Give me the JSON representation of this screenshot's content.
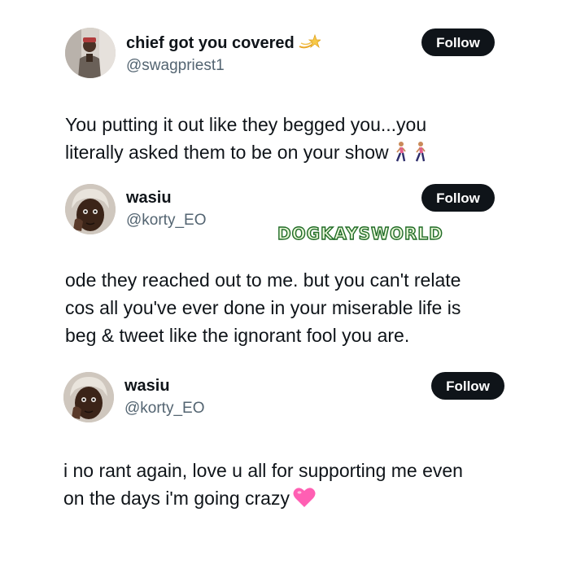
{
  "watermark": "DOGKAYSWORLD",
  "posts": [
    {
      "display_name": "chief got you covered",
      "name_icon": "dizzy-star-icon",
      "handle": "@swagpriest1",
      "follow_label": "Follow",
      "lines": [
        "You putting it out like they begged you...you",
        "literally asked them to be on your show"
      ],
      "trailing_icons": [
        "woman-walking-icon",
        "woman-walking-icon"
      ]
    },
    {
      "display_name": "wasiu",
      "handle": "@korty_EO",
      "follow_label": "Follow",
      "lines": [
        "ode they reached out to me. but you can't relate",
        "cos all you've ever done in your miserable life is",
        "beg & tweet like the ignorant fool you are."
      ]
    },
    {
      "display_name": "wasiu",
      "handle": "@korty_EO",
      "follow_label": "Follow",
      "lines": [
        "i no rant again, love u all for supporting me even",
        "on the days i'm going crazy"
      ],
      "trailing_icons": [
        "pink-heart-icon"
      ]
    }
  ],
  "colors": {
    "text": "#0f1419",
    "handle": "#536471",
    "button_bg": "#0f1419",
    "button_text": "#ffffff",
    "watermark_fill": "#e8f6d7",
    "watermark_stroke": "#1f6b25",
    "heart": "#ff5fb3"
  }
}
